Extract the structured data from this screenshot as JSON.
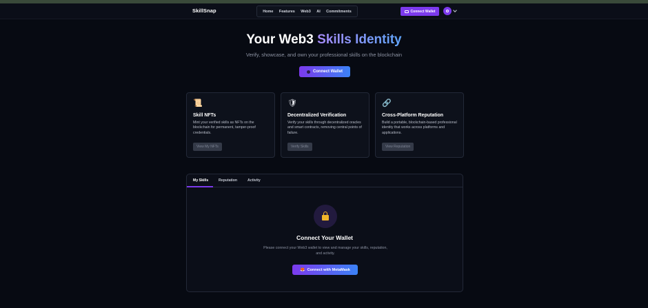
{
  "nav": {
    "brand": "SkillSnap",
    "links": [
      "Home",
      "Features",
      "Web3",
      "AI",
      "Commitments"
    ],
    "connect_label": "Connect Wallet",
    "connect_icon": "wallet-icon",
    "avatar_icon": "user-icon"
  },
  "hero": {
    "title_prefix": "Your Web3 ",
    "title_accent": "Skills Identity",
    "subtitle": "Verify, showcase, and own your professional skills on the blockchain",
    "button_label": "Connect Wallet"
  },
  "cards": [
    {
      "icon": "📜",
      "icon_name": "scroll-icon",
      "title": "Skill NFTs",
      "description": "Mint your verified skills as NFTs on the blockchain for permanent, tamper-proof credentials.",
      "button": "View My NFTs"
    },
    {
      "icon": "🛡",
      "icon_name": "shield-icon",
      "title": "Decentralized Verification",
      "description": "Verify your skills through decentralized oracles and smart contracts, removing central points of failure.",
      "button": "Verify Skills"
    },
    {
      "icon": "🔗",
      "icon_name": "link-icon",
      "title": "Cross-Platform Reputation",
      "description": "Build a portable, blockchain-based professional identity that works across platforms and applications.",
      "button": "View Reputation"
    }
  ],
  "panel": {
    "tabs": [
      "My Skills",
      "Reputation",
      "Activity"
    ],
    "active_tab": "My Skills",
    "lock_icon": "lock-icon",
    "title": "Connect Your Wallet",
    "description": "Please connect your Web3 wallet to view and manage your skills, reputation, and activity.",
    "button_icon": "🦊",
    "button_label": "Connect with MetaMask"
  },
  "colors": {
    "background": "#070a12",
    "accent_purple": "#7c3aed",
    "accent_blue": "#3b82f6",
    "lock_yellow": "#f0b429"
  }
}
